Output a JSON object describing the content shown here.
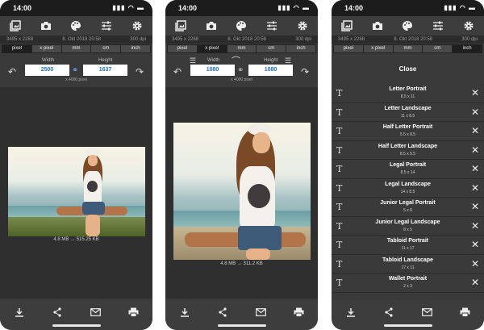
{
  "status_time": "14:00",
  "status_icons": "▮▮▮ ◠ ▬",
  "toolbar_icons": [
    "photo-library-icon",
    "camera-icon",
    "palette-icon",
    "sliders-icon",
    "gear-icon"
  ],
  "info": {
    "dims": "3495 x 2288",
    "date": "8. Okt 2018 20:58",
    "dpi": "300 dpi"
  },
  "units": [
    "pixel",
    "x pixel",
    "mm",
    "cm",
    "inch"
  ],
  "screen1": {
    "active_unit": "pixel",
    "width_label": "Width",
    "height_label": "Height",
    "width_value": "2500",
    "height_value": "1637",
    "sub": "x 4000 pixel",
    "file_info": "4.8 MB  →  515.25 KB"
  },
  "screen2": {
    "active_unit": "x pixel",
    "width_label": "Width",
    "height_label": "Height",
    "width_value": "1080",
    "height_value": "1080",
    "sub": "x 4000 pixel",
    "file_info": "4.8 MB  →  311.2 KB"
  },
  "screen3": {
    "active_unit": "inch",
    "close_label": "Close",
    "presets": [
      {
        "name": "Letter Portrait",
        "dims": "8.5 x 11"
      },
      {
        "name": "Letter Landscape",
        "dims": "11 x 8.5"
      },
      {
        "name": "Half Letter Portrait",
        "dims": "5.5 x 8.5"
      },
      {
        "name": "Half Letter Landscape",
        "dims": "8.5 x 5.5"
      },
      {
        "name": "Legal Portrait",
        "dims": "8.5 x 14"
      },
      {
        "name": "Legal Landscape",
        "dims": "14 x 8.5"
      },
      {
        "name": "Junior Legal Portrait",
        "dims": "5 x 8"
      },
      {
        "name": "Junior Legal Landscape",
        "dims": "8 x 5"
      },
      {
        "name": "Tabloid Portrait",
        "dims": "11 x 17"
      },
      {
        "name": "Tabloid Landscape",
        "dims": "17 x 11"
      },
      {
        "name": "Wallet Portrait",
        "dims": "2 x 3"
      }
    ]
  },
  "bottom_icons": [
    "download-icon",
    "share-icon",
    "mail-icon",
    "print-icon"
  ],
  "colors": {
    "value_text": "#1f6fd6",
    "panel": "#3a3a3a",
    "active_unit": "#1f1f1f"
  }
}
